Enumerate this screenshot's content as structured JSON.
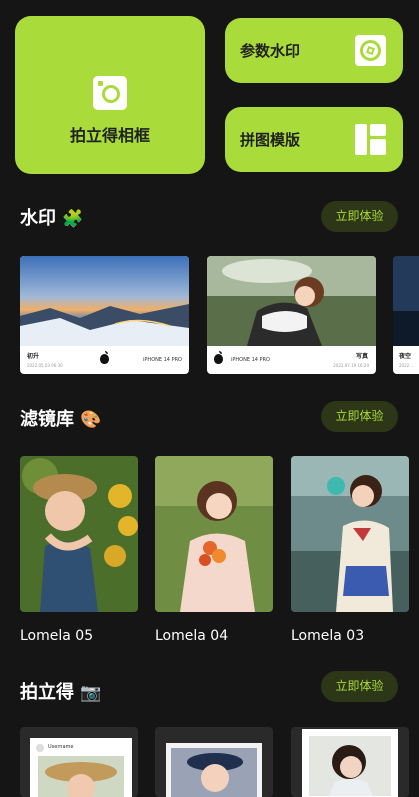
{
  "tiles": {
    "instant_frame": {
      "label": "拍立得相框",
      "icon": "camera-icon"
    },
    "param_watermark": {
      "label": "参数水印",
      "icon": "aperture-icon"
    },
    "collage": {
      "label": "拼图模版",
      "icon": "layout-icon"
    }
  },
  "sections": {
    "watermark": {
      "title": "水印",
      "emoji": "🧩",
      "button": "立即体验",
      "cards": [
        {
          "left_title": "初升",
          "left_sub": "2022.05.03 06:30",
          "right_text": "iPHONE 14 PRO"
        },
        {
          "left_text": "iPHONE 14 PRO",
          "right_title": "写真",
          "right_sub": "2022.07.19 16:24"
        },
        {
          "left_title": "夜空",
          "left_sub": "2022..."
        }
      ]
    },
    "filters": {
      "title": "滤镜库",
      "emoji": "🎨",
      "button": "立即体验",
      "items": [
        {
          "name": "Lomela 05"
        },
        {
          "name": "Lomela 04"
        },
        {
          "name": "Lomela 03"
        }
      ]
    },
    "instant": {
      "title": "拍立得",
      "emoji": "📷",
      "button": "立即体验",
      "items": [
        {
          "handle": "Username"
        },
        {},
        {}
      ]
    }
  },
  "colors": {
    "accent": "#a9dc3b",
    "background": "#151515",
    "button_bg": "#2d3616"
  }
}
